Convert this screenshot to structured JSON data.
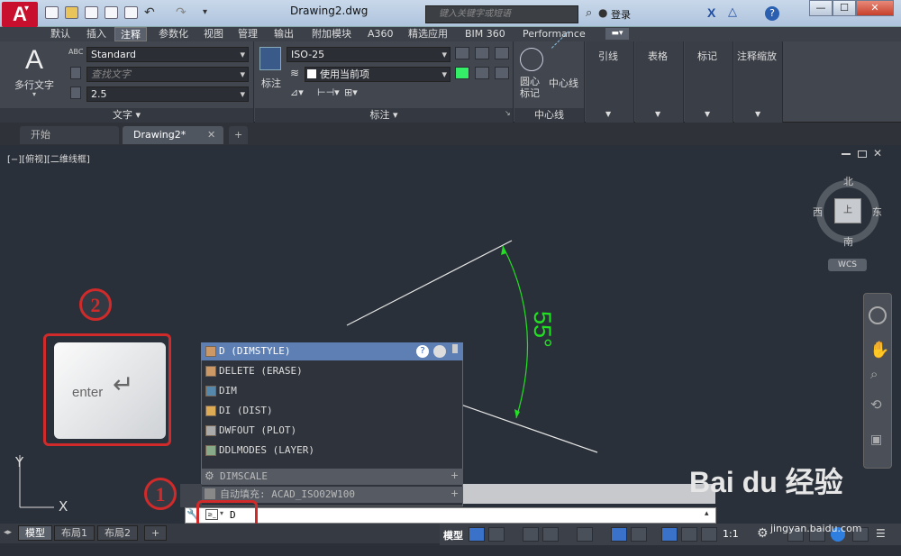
{
  "app": {
    "logo": "A",
    "doc_title": "Drawing2.dwg",
    "search_placeholder": "键入关键字或短语",
    "login": "登录",
    "help": "?",
    "win_min": "—",
    "win_max": "☐",
    "win_close": "✕"
  },
  "ribbon_tabs": [
    {
      "label": "默认"
    },
    {
      "label": "插入"
    },
    {
      "label": "注释",
      "active": true
    },
    {
      "label": "参数化"
    },
    {
      "label": "视图"
    },
    {
      "label": "管理"
    },
    {
      "label": "输出"
    },
    {
      "label": "附加模块"
    },
    {
      "label": "A360"
    },
    {
      "label": "精选应用"
    },
    {
      "label": "BIM 360"
    },
    {
      "label": "Performance"
    }
  ],
  "text_panel": {
    "title": "文字 ▾",
    "mtext_label": "多行文字",
    "style": "Standard",
    "find_placeholder": "查找文字",
    "height": "2.5",
    "mtext_icon_glyph": "A"
  },
  "dim_panel": {
    "title": "标注 ▾",
    "dim_label": "标注",
    "dim_style": "ISO-25",
    "layer": "使用当前项"
  },
  "center_panel": {
    "title": "中心线",
    "center_mark": "圆心\n标记",
    "center_line": "中心线"
  },
  "other_panels": [
    {
      "label": "引线"
    },
    {
      "label": "表格"
    },
    {
      "label": "标记"
    },
    {
      "label": "注释缩放"
    }
  ],
  "file_tabs": [
    {
      "label": "开始"
    },
    {
      "label": "Drawing2*",
      "active": true
    },
    {
      "label": "+"
    }
  ],
  "viewport_label": "[−][俯视][二维线框]",
  "viewcube": {
    "north": "北",
    "south": "南",
    "east": "东",
    "west": "西",
    "top": "上",
    "wcs": "WCS"
  },
  "angle_text": "55°",
  "ucs": {
    "x": "X",
    "y": "Y"
  },
  "autocomplete": {
    "header": "D (DIMSTYLE)",
    "items": [
      {
        "label": "DELETE (ERASE)"
      },
      {
        "label": "DIM"
      },
      {
        "label": "DI (DIST)"
      },
      {
        "label": "DWFOUT (PLOT)"
      },
      {
        "label": "DDLMODES (LAYER)"
      }
    ],
    "sysvar": "DIMSCALE",
    "filesearch": "自动填充: ACAD_ISO02W100"
  },
  "command": {
    "text": "D",
    "prompt": "≥_"
  },
  "layout_tabs": [
    {
      "label": "模型",
      "active": true
    },
    {
      "label": "布局1"
    },
    {
      "label": "布局2"
    },
    {
      "label": "+"
    }
  ],
  "status": {
    "model": "模型",
    "scale": "1:1"
  },
  "annotations": {
    "one": "1",
    "two": "2",
    "enter_key": "enter"
  },
  "watermark": {
    "brand": "Bai du 经验",
    "url": "jingyan.baidu.com"
  },
  "colors": {
    "accent_red": "#d12a2a",
    "angle_green": "#22e022",
    "highlight": "#5d7fb4"
  }
}
